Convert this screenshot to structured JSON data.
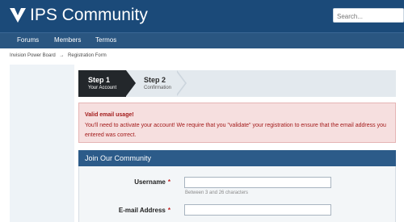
{
  "header": {
    "brand": "IPS Community",
    "search_placeholder": "Search..."
  },
  "nav": {
    "items": [
      {
        "label": "Forums"
      },
      {
        "label": "Members"
      },
      {
        "label": "Termos"
      }
    ]
  },
  "breadcrumb": {
    "items": [
      "Invision Power Board",
      "Registration Form"
    ],
    "separator": "→"
  },
  "steps": [
    {
      "title": "Step 1",
      "subtitle": "Your Account",
      "state": "active"
    },
    {
      "title": "Step 2",
      "subtitle": "Confirmation",
      "state": "inactive"
    }
  ],
  "alert": {
    "title": "Valid email usage!",
    "text": "You'll need to activate your account! We require that you \"validate\" your registration to ensure that the email address you entered was correct."
  },
  "form": {
    "title": "Join Our Community",
    "username_label": "Username",
    "username_hint": "Between 3 and 26 characters",
    "email_label": "E-mail Address",
    "required_marker": "*"
  },
  "colors": {
    "header_bg": "#1b4a79",
    "nav_bg": "#2a5681",
    "panel_head_bg": "#2c5b89",
    "alert_bg": "#f6dfdf",
    "alert_text": "#a31b1b",
    "step_active_bg": "#23272b"
  }
}
